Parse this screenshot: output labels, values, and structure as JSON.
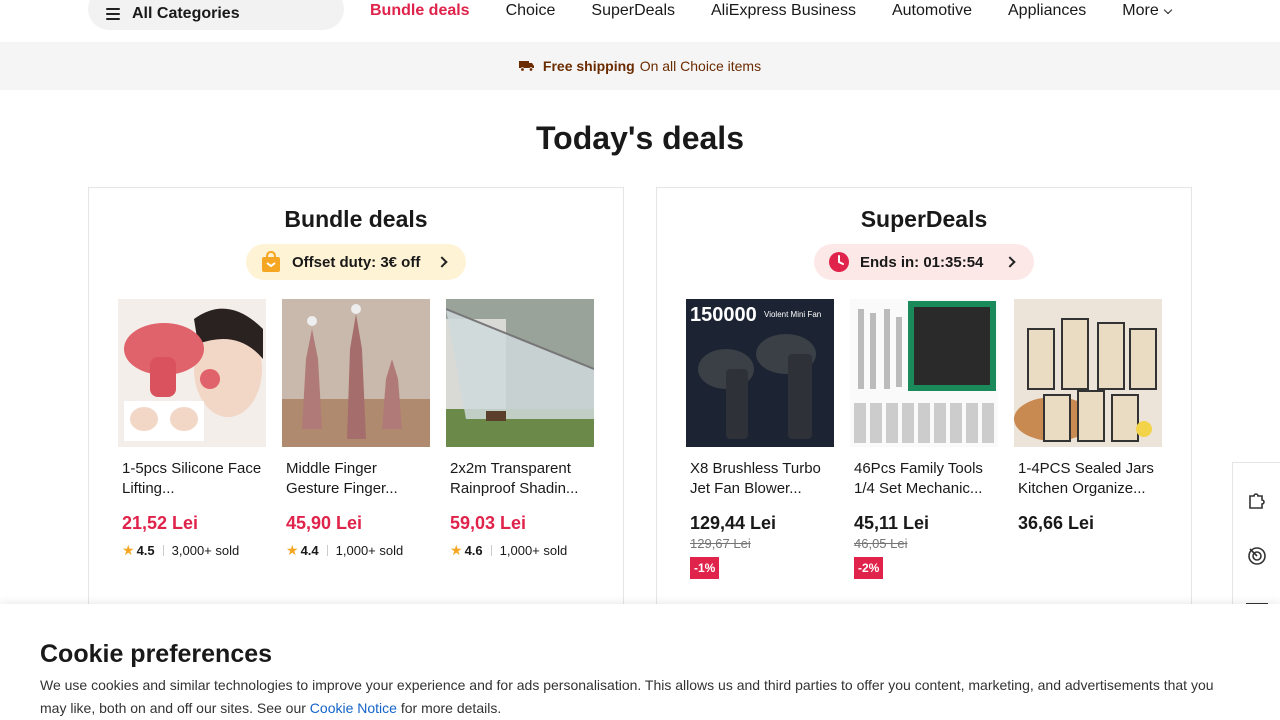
{
  "nav": {
    "all_categories": "All Categories",
    "items": [
      "Bundle deals",
      "Choice",
      "SuperDeals",
      "AliExpress Business",
      "Automotive",
      "Appliances"
    ],
    "more": "More"
  },
  "shipping": {
    "strong": "Free shipping",
    "light": "On all Choice items"
  },
  "page_title": "Today's deals",
  "bundle": {
    "title": "Bundle deals",
    "pill": "Offset duty: 3€ off",
    "products": [
      {
        "name": "1-5pcs Silicone Face Lifting...",
        "price": "21,52 Lei",
        "rating": "4.5",
        "sold": "3,000+ sold"
      },
      {
        "name": "Middle Finger Gesture Finger...",
        "price": "45,90 Lei",
        "rating": "4.4",
        "sold": "1,000+ sold"
      },
      {
        "name": "2x2m Transparent Rainproof Shadin...",
        "price": "59,03 Lei",
        "rating": "4.6",
        "sold": "1,000+ sold"
      }
    ]
  },
  "superdeals": {
    "title": "SuperDeals",
    "pill": "Ends in: 01:35:54",
    "products": [
      {
        "name": "X8 Brushless Turbo Jet Fan Blower...",
        "price": "129,44 Lei",
        "old_price": "129,67 Lei",
        "discount": "-1%",
        "image_text": "150000",
        "image_caption": "Violent Mini Fan"
      },
      {
        "name": "46Pcs Family Tools 1/4 Set Mechanic...",
        "price": "45,11 Lei",
        "old_price": "46,05 Lei",
        "discount": "-2%"
      },
      {
        "name": "1-4PCS Sealed Jars Kitchen Organize...",
        "price": "36,66 Lei"
      }
    ]
  },
  "cookie": {
    "title": "Cookie preferences",
    "text_before": "We use cookies and similar technologies to improve your experience and for ads personalisation. This allows us and third parties to offer you content, marketing, and advertisements that you may like, both on and off our sites. See our ",
    "link": "Cookie Notice",
    "text_after": " for more details."
  },
  "colors": {
    "accent": "#e0234b",
    "shipping_text": "#6b2b00",
    "link": "#1463c8"
  }
}
